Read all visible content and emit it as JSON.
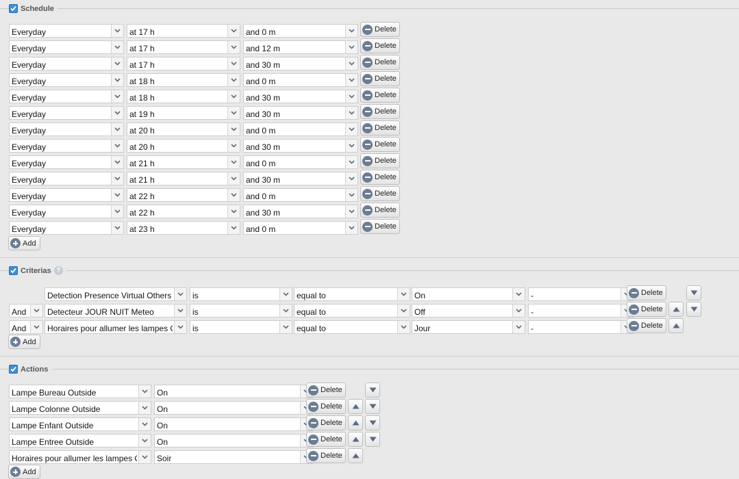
{
  "schedule": {
    "title": "Schedule",
    "rows": [
      {
        "day": "Everyday",
        "hour": "at 17 h",
        "minute": "and 0 m"
      },
      {
        "day": "Everyday",
        "hour": "at 17 h",
        "minute": "and 12 m"
      },
      {
        "day": "Everyday",
        "hour": "at 17 h",
        "minute": "and 30 m"
      },
      {
        "day": "Everyday",
        "hour": "at 18 h",
        "minute": "and 0 m"
      },
      {
        "day": "Everyday",
        "hour": "at 18 h",
        "minute": "and 30 m"
      },
      {
        "day": "Everyday",
        "hour": "at 19 h",
        "minute": "and 30 m"
      },
      {
        "day": "Everyday",
        "hour": "at 20 h",
        "minute": "and 0 m"
      },
      {
        "day": "Everyday",
        "hour": "at 20 h",
        "minute": "and 30 m"
      },
      {
        "day": "Everyday",
        "hour": "at 21 h",
        "minute": "and 0 m"
      },
      {
        "day": "Everyday",
        "hour": "at 21 h",
        "minute": "and 30 m"
      },
      {
        "day": "Everyday",
        "hour": "at 22 h",
        "minute": "and 0 m"
      },
      {
        "day": "Everyday",
        "hour": "at 22 h",
        "minute": "and 30 m"
      },
      {
        "day": "Everyday",
        "hour": "at 23 h",
        "minute": "and 0 m"
      }
    ],
    "delete_label": "Delete",
    "add_label": "Add"
  },
  "criterias": {
    "title": "Criterias",
    "help_icon": "question-icon",
    "help_glyph": "?",
    "rows": [
      {
        "conj": "",
        "device": "Detection Presence Virtual Others",
        "verb": "is",
        "op": "equal to",
        "value": "On",
        "extra": "-",
        "up": false,
        "down": true
      },
      {
        "conj": "And",
        "device": "Detecteur JOUR NUIT Meteo",
        "verb": "is",
        "op": "equal to",
        "value": "Off",
        "extra": "-",
        "up": true,
        "down": true
      },
      {
        "conj": "And",
        "device": "Horaires pour allumer les lampes O",
        "verb": "is",
        "op": "equal to",
        "value": "Jour",
        "extra": "-",
        "up": true,
        "down": false
      }
    ],
    "delete_label": "Delete",
    "add_label": "Add"
  },
  "actions": {
    "title": "Actions",
    "rows": [
      {
        "device": "Lampe Bureau Outside",
        "value": "On",
        "up": false,
        "down": true
      },
      {
        "device": "Lampe Colonne Outside",
        "value": "On",
        "up": true,
        "down": true
      },
      {
        "device": "Lampe Enfant Outside",
        "value": "On",
        "up": true,
        "down": true
      },
      {
        "device": "Lampe Entree Outside",
        "value": "On",
        "up": true,
        "down": true
      },
      {
        "device": "Horaires pour allumer les lampes O",
        "value": "Soir",
        "up": true,
        "down": false
      }
    ],
    "delete_label": "Delete",
    "add_label": "Add"
  },
  "colors": {
    "page_bg": "#e9e9e9",
    "checkbox": "#3c8fd8",
    "button_icon": "#6b7d93",
    "arrow": "#5a6b80"
  }
}
